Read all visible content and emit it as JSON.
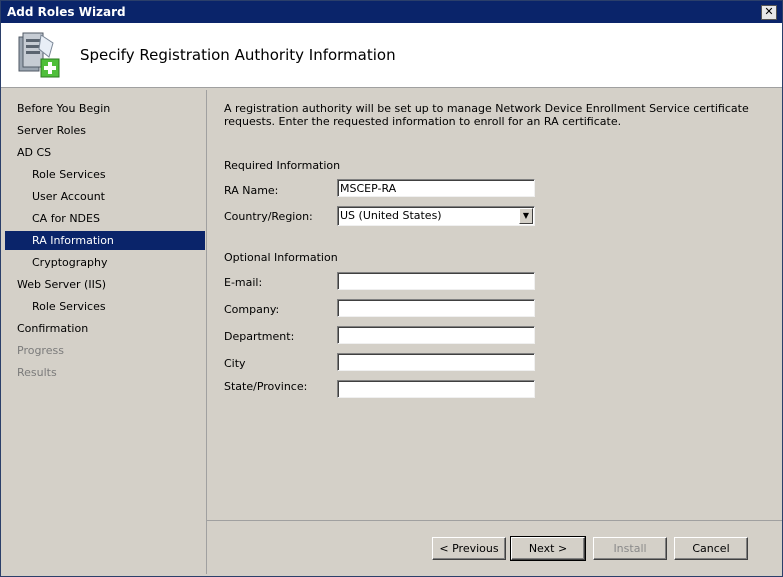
{
  "window": {
    "title": "Add Roles Wizard",
    "close_glyph": "✕"
  },
  "header": {
    "title": "Specify Registration Authority Information",
    "icon": "server-add-icon"
  },
  "nav": {
    "items": [
      {
        "label": "Before You Begin",
        "state": "normal"
      },
      {
        "label": "Server Roles",
        "state": "normal"
      },
      {
        "label": "AD CS",
        "state": "normal"
      },
      {
        "label": "Role Services",
        "state": "normal"
      },
      {
        "label": "User Account",
        "state": "normal"
      },
      {
        "label": "CA for NDES",
        "state": "normal"
      },
      {
        "label": "RA Information",
        "state": "selected"
      },
      {
        "label": "Cryptography",
        "state": "normal"
      },
      {
        "label": "Web Server (IIS)",
        "state": "normal"
      },
      {
        "label": "Role Services",
        "state": "normal"
      },
      {
        "label": "Confirmation",
        "state": "normal"
      },
      {
        "label": "Progress",
        "state": "disabled"
      },
      {
        "label": "Results",
        "state": "disabled"
      }
    ]
  },
  "main": {
    "description": "A registration authority will be set up to manage Network Device Enrollment Service certificate requests. Enter the requested information to enroll for an RA certificate.",
    "required_heading": "Required Information",
    "ra_name_label": "RA Name:",
    "ra_name_value": "MSCEP-RA",
    "country_label": "Country/Region:",
    "country_value": "US (United States)",
    "optional_heading": "Optional Information",
    "email_label": "E-mail:",
    "company_label": "Company:",
    "department_label": "Department:",
    "city_label": "City",
    "state_label": "State/Province:"
  },
  "buttons": {
    "previous": "< Previous",
    "next": "Next >",
    "install": "Install",
    "cancel": "Cancel"
  },
  "colors": {
    "selection": "#0a246a",
    "titlebar": "#0a246a"
  }
}
